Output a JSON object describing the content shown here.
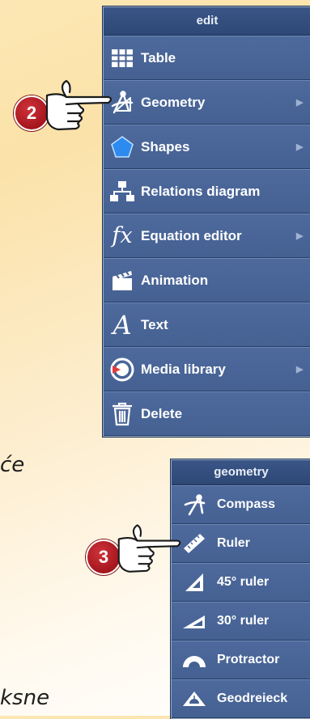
{
  "background_text": {
    "line1": "će",
    "line2": "ksne"
  },
  "menu_edit": {
    "title": "edit",
    "items": [
      {
        "label": "Table",
        "icon": "table-icon",
        "submenu": false
      },
      {
        "label": "Geometry",
        "icon": "compass-triangle-icon",
        "submenu": true
      },
      {
        "label": "Shapes",
        "icon": "pentagon-icon",
        "submenu": true
      },
      {
        "label": "Relations diagram",
        "icon": "org-chart-icon",
        "submenu": false
      },
      {
        "label": "Equation editor",
        "icon": "fx-icon",
        "submenu": true
      },
      {
        "label": "Animation",
        "icon": "clapperboard-icon",
        "submenu": false
      },
      {
        "label": "Text",
        "icon": "text-a-icon",
        "submenu": false
      },
      {
        "label": "Media library",
        "icon": "media-icon",
        "submenu": true
      },
      {
        "label": "Delete",
        "icon": "trash-icon",
        "submenu": false
      }
    ]
  },
  "menu_geometry": {
    "title": "geometry",
    "items": [
      {
        "label": "Compass",
        "icon": "compass-icon"
      },
      {
        "label": "Ruler",
        "icon": "ruler-icon"
      },
      {
        "label": "45° ruler",
        "icon": "set-square-45-icon"
      },
      {
        "label": "30° ruler",
        "icon": "set-square-30-icon"
      },
      {
        "label": "Protractor",
        "icon": "protractor-icon"
      },
      {
        "label": "Geodreieck",
        "icon": "geodreieck-icon"
      }
    ]
  },
  "callouts": {
    "step2": "2",
    "step3": "3"
  },
  "colors": {
    "menu_bg": "#456192",
    "header_bg": "#2d4875",
    "badge": "#b51d24",
    "arrow": "#9fb2d3"
  }
}
